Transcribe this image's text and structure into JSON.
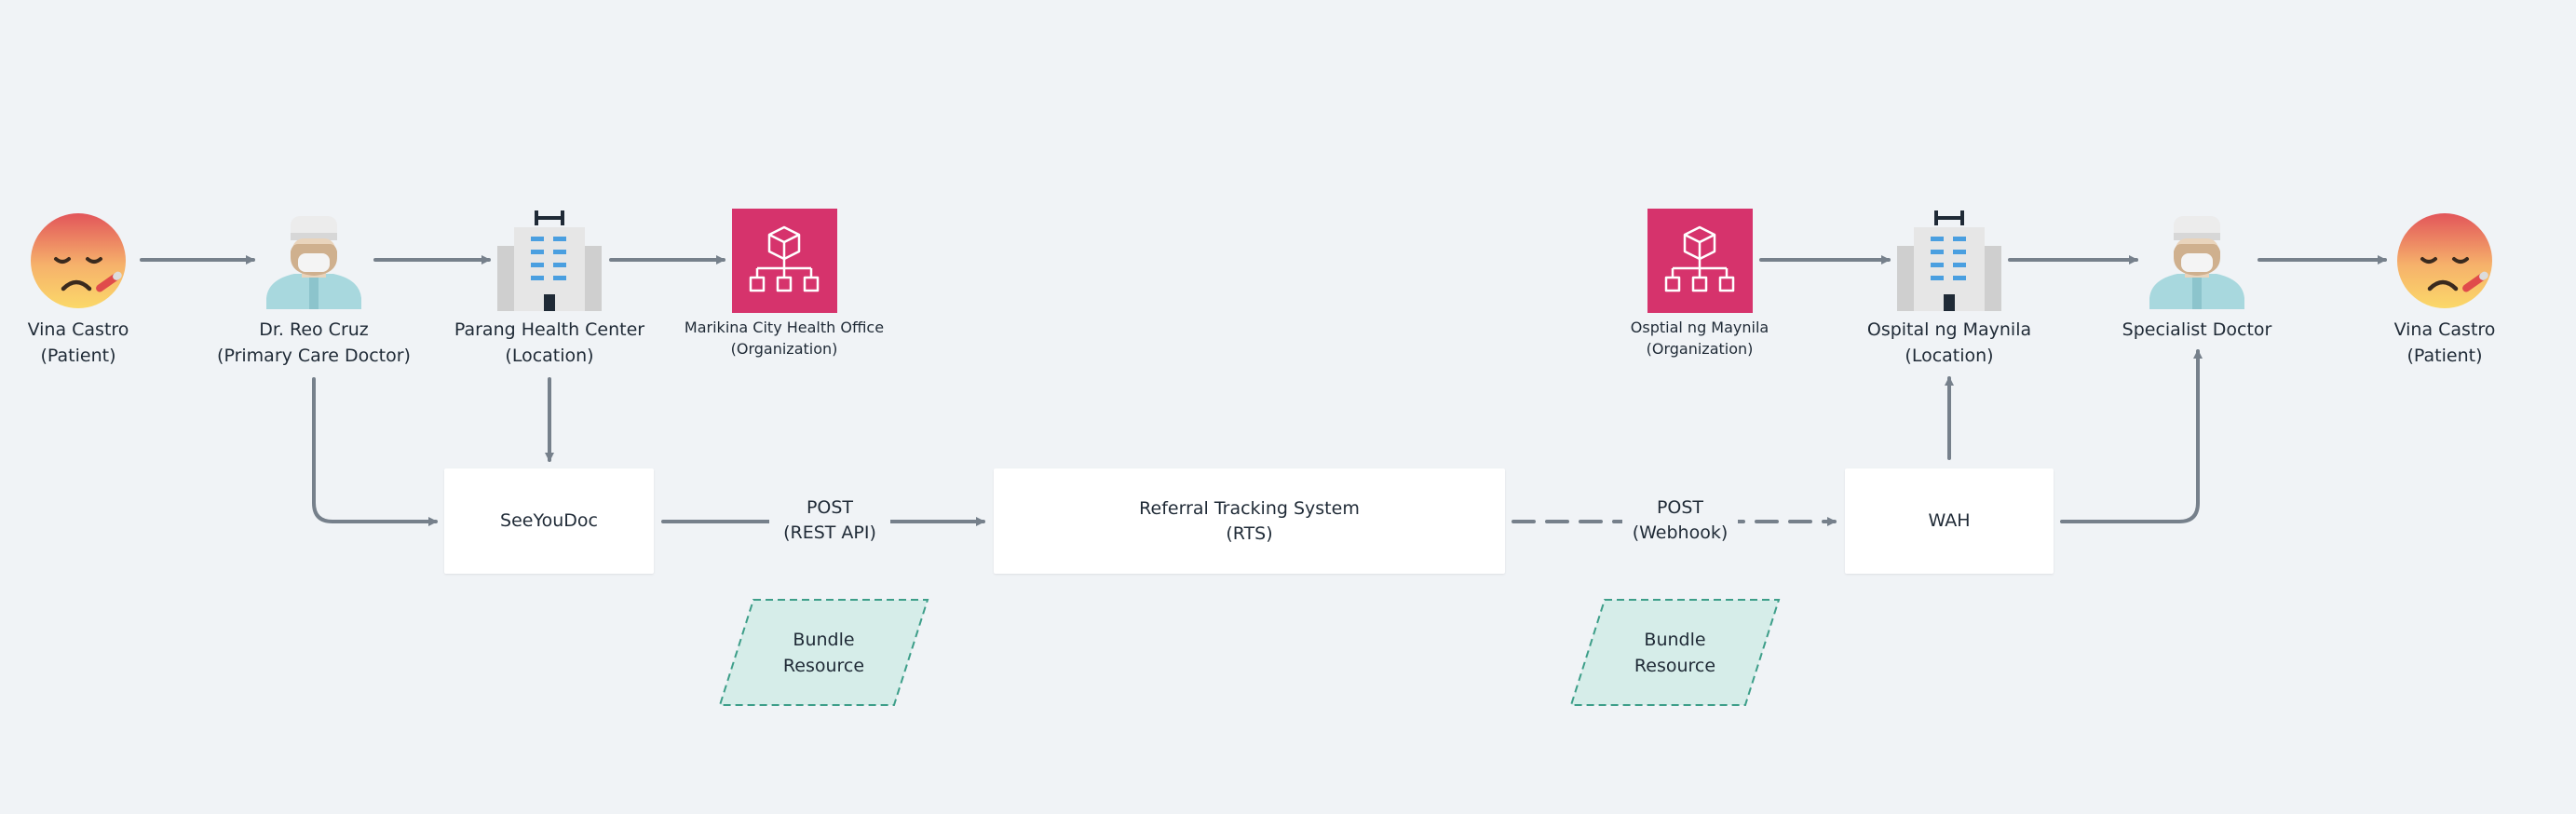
{
  "colors": {
    "line": "#76808b",
    "org_bg": "#d6336c",
    "bundle_fill": "#d6ede9",
    "bundle_stroke": "#3d9e89",
    "background": "#f0f3f6"
  },
  "nodes": {
    "patient_left": {
      "icon": "sick-patient-icon",
      "line1": "Vina Castro",
      "line2": "(Patient)"
    },
    "primary_doctor": {
      "icon": "doctor-icon",
      "line1": "Dr. Reo Cruz",
      "line2": "(Primary Care Doctor)"
    },
    "parang_location": {
      "icon": "hospital-icon",
      "line1": "Parang Health Center",
      "line2": "(Location)"
    },
    "marikina_org": {
      "icon": "organization-icon",
      "line1": "Marikina City Health Office",
      "line2": "(Organization)"
    },
    "maynila_org": {
      "icon": "organization-icon",
      "line1": "Osptial ng Maynila",
      "line2": "(Organization)"
    },
    "maynila_location": {
      "icon": "hospital-icon",
      "line1": "Ospital ng Maynila",
      "line2": "(Location)"
    },
    "specialist": {
      "icon": "doctor-icon",
      "line1": "Specialist Doctor"
    },
    "patient_right": {
      "icon": "sick-patient-icon",
      "line1": "Vina Castro",
      "line2": "(Patient)"
    }
  },
  "systems": {
    "seeyoudoc": {
      "line1": "SeeYouDoc"
    },
    "rts": {
      "line1": "Referral Tracking System",
      "line2": "(RTS)"
    },
    "wah": {
      "line1": "WAH"
    }
  },
  "edges": {
    "post_rest": {
      "line1": "POST",
      "line2": "(REST API)"
    },
    "post_webhook": {
      "line1": "POST",
      "line2": "(Webhook)"
    }
  },
  "bundles": {
    "left": {
      "line1": "Bundle",
      "line2": "Resource"
    },
    "right": {
      "line1": "Bundle",
      "line2": "Resource"
    }
  }
}
